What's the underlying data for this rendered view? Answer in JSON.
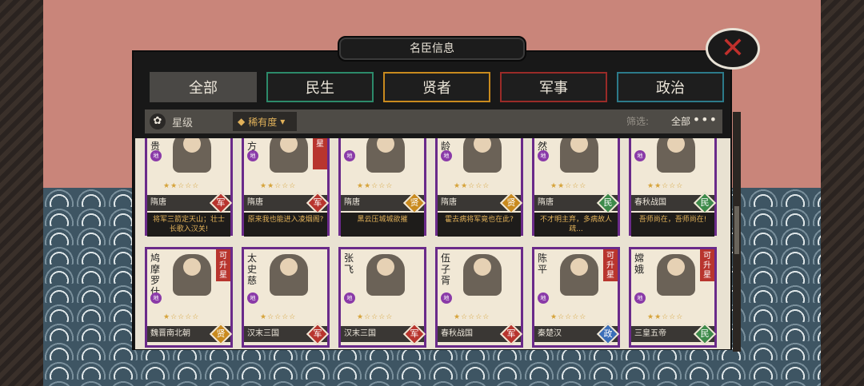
{
  "title": "名臣信息",
  "colors": {
    "military": "#b8352e",
    "sage": "#c98a1e",
    "people": "#3d8a4a",
    "politics": "#3a6db8",
    "frame": "#6a2a8a"
  },
  "tabs": [
    {
      "label": "全部",
      "color": "#4a4845",
      "active": true
    },
    {
      "label": "民生",
      "color": "#2c8a6a",
      "active": false
    },
    {
      "label": "贤者",
      "color": "#c98a1e",
      "active": false
    },
    {
      "label": "军事",
      "color": "#9a2b28",
      "active": false
    },
    {
      "label": "政治",
      "color": "#2c7a8a",
      "active": false
    }
  ],
  "filterbar": {
    "sort1": "星级",
    "sort1_icon": "flower-icon",
    "sort2": "稀有度",
    "filter_label": "筛选:",
    "filter_value": "全部",
    "more": "•••"
  },
  "close_icon": "close-x-icon",
  "seal_text": "地",
  "cards_row1": [
    {
      "name": "贵",
      "era": "隋唐",
      "category": "军",
      "cat_color": "#b8352e",
      "stars": 2,
      "quote": "将军三箭定天山；壮士长歌入汉关!",
      "upgrade": ""
    },
    {
      "name": "方",
      "era": "隋唐",
      "category": "军",
      "cat_color": "#b8352e",
      "stars": 2,
      "quote": "原来我也能进入凌烟阁?",
      "upgrade": "星"
    },
    {
      "name": "",
      "era": "隋唐",
      "category": "贤",
      "cat_color": "#c98a1e",
      "stars": 2,
      "quote": "黑云压城城欲摧",
      "upgrade": ""
    },
    {
      "name": "龄",
      "era": "隋唐",
      "category": "贤",
      "cat_color": "#c98a1e",
      "stars": 2,
      "quote": "霍去病将军竟也在此?",
      "upgrade": ""
    },
    {
      "name": "然",
      "era": "隋唐",
      "category": "民",
      "cat_color": "#3d8a4a",
      "stars": 2,
      "quote": "不才明主弃，多病故人疏...",
      "upgrade": ""
    },
    {
      "name": "",
      "era": "春秋战国",
      "category": "民",
      "cat_color": "#3d8a4a",
      "stars": 2,
      "quote": "吾师尚在，吾师尚在!",
      "upgrade": ""
    }
  ],
  "cards_row2": [
    {
      "name": "鸠摩罗什",
      "era": "魏晋南北朝",
      "category": "贤",
      "cat_color": "#c98a1e",
      "stars": 1,
      "upgrade": "可升星"
    },
    {
      "name": "太史慈",
      "era": "汉末三国",
      "category": "军",
      "cat_color": "#b8352e",
      "stars": 1,
      "upgrade": ""
    },
    {
      "name": "张飞",
      "era": "汉末三国",
      "category": "军",
      "cat_color": "#b8352e",
      "stars": 1,
      "upgrade": ""
    },
    {
      "name": "伍子胥",
      "era": "春秋战国",
      "category": "军",
      "cat_color": "#b8352e",
      "stars": 1,
      "upgrade": ""
    },
    {
      "name": "陈平",
      "era": "秦楚汉",
      "category": "政",
      "cat_color": "#3a6db8",
      "stars": 1,
      "upgrade": "可升星"
    },
    {
      "name": "嫦娥",
      "era": "三皇五帝",
      "category": "民",
      "cat_color": "#3d8a4a",
      "stars": 2,
      "upgrade": "可升星"
    }
  ]
}
